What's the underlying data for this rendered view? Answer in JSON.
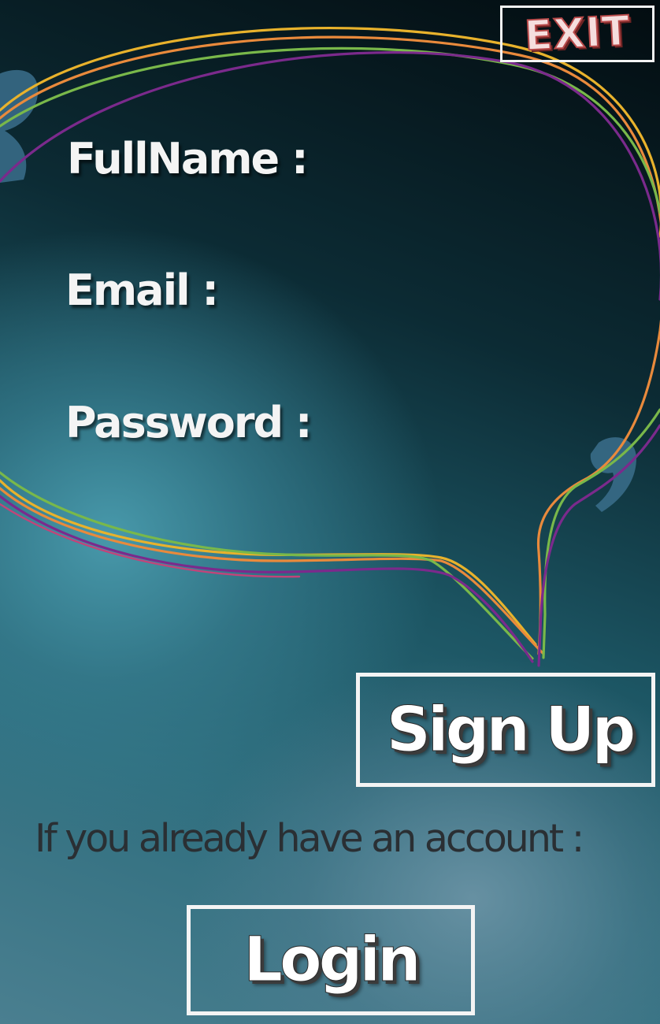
{
  "header": {
    "exit_label": "EXIT"
  },
  "form": {
    "fullname_label": "FullName :",
    "email_label": "Email :",
    "password_label": "Password :"
  },
  "actions": {
    "signup_label": "Sign Up",
    "account_prompt": "If you already have an account :",
    "login_label": "Login"
  },
  "colors": {
    "exit_text": "#f5dede",
    "exit_outline": "#b84a4a",
    "button_border": "#f4f4f4",
    "prompt_text": "#2a2f33",
    "bubble_yellow": "#e8b22c",
    "bubble_orange": "#e98a3c",
    "bubble_green": "#79b84a",
    "bubble_purple": "#7b2a8c"
  },
  "decorations": {
    "bubble_icon": "speech-bubble-icon",
    "quote_icon": "quotation-mark-icon"
  }
}
